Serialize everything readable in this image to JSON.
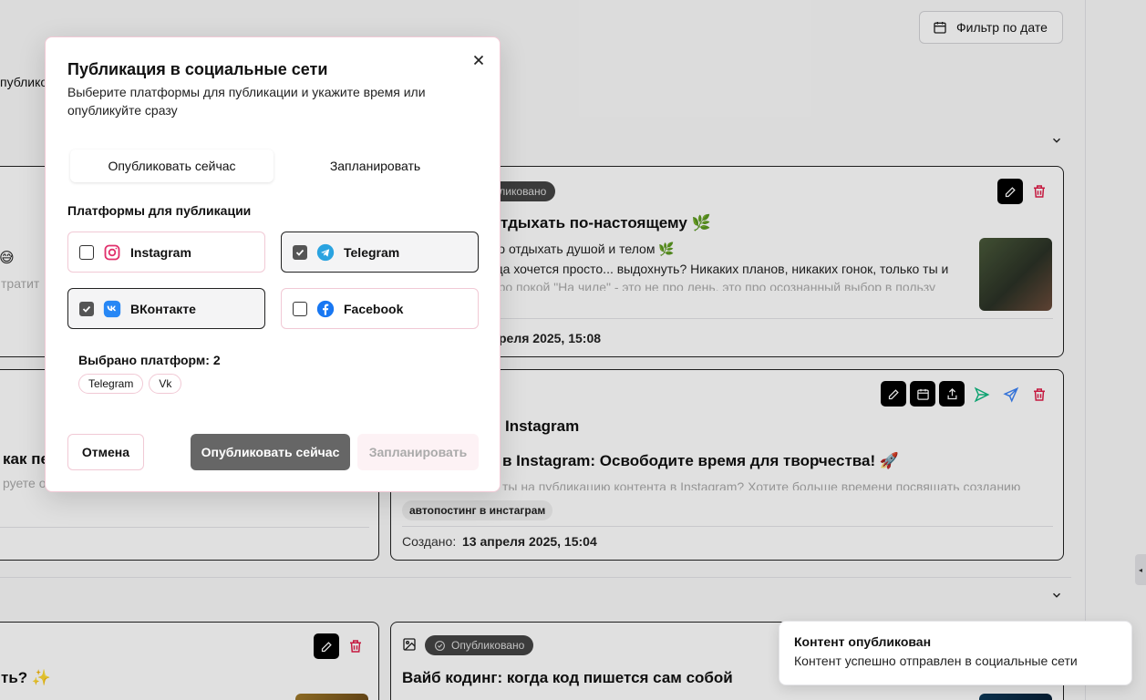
{
  "background": {
    "date_filter_label": "Фильтр по дате",
    "left_clip_text": "публико",
    "card_top_right": {
      "status": "Опубликовано",
      "title": "отдыхать по-настоящему 🌿",
      "line1": "во отдыхать душой и телом 🌿",
      "line2": "гда хочется просто... выдохнуть? Никаких планов, никаких гонок, только ты и",
      "line3": "про покой \"На чиле\" - это не про лень, это про осознанный выбор в пользу",
      "created": "реля 2025, 15:08"
    },
    "card_mid_right": {
      "title_prefix": "Instagram",
      "title": "в Instagram: Освободите время для творчества! 🚀",
      "line1": "ты на публикацию контента в Instagram? Хотите больше времени посвящать созданию",
      "tag": "автопостинг в инстаграм",
      "created_label": "Создано:",
      "created_value": "13 апреля 2025, 15:04"
    },
    "card_left_top": {
      "emoji": "😅",
      "text": "тратит"
    },
    "card_left_mid": {
      "line1": "как пе",
      "line2": "руете от"
    },
    "card_left_bottom": {
      "title": "ть? ✨"
    },
    "card_bottom_right": {
      "status": "Опубликовано",
      "title": "Вайб кодинг: когда код пишется сам собой"
    }
  },
  "modal": {
    "title": "Публикация в социальные сети",
    "description": "Выберите платформы для публикации и укажите время или опубликуйте сразу",
    "tabs": [
      {
        "label": "Опубликовать сейчас",
        "active": true
      },
      {
        "label": "Запланировать",
        "active": false
      }
    ],
    "platforms_label": "Платформы для публикации",
    "platforms": [
      {
        "name": "Instagram",
        "checked": false,
        "icon": "instagram-icon",
        "color": "#e1306c"
      },
      {
        "name": "Telegram",
        "checked": true,
        "icon": "telegram-icon",
        "color": "#2aa3e0"
      },
      {
        "name": "ВКонтакте",
        "checked": true,
        "icon": "vk-icon",
        "color": "#2787f5"
      },
      {
        "name": "Facebook",
        "checked": false,
        "icon": "facebook-icon",
        "color": "#1877f2"
      }
    ],
    "selected_count_text": "Выбрано платформ: 2",
    "selected_chips": [
      "Telegram",
      "Vk"
    ],
    "cancel_label": "Отмена",
    "publish_label": "Опубликовать сейчас",
    "schedule_label": "Запланировать"
  },
  "toast": {
    "title": "Контент опубликован",
    "description": "Контент успешно отправлен в социальные сети"
  },
  "colors": {
    "accent_border": "#f1c9d5",
    "publish_button": "#666666",
    "delete_red": "#e11d48",
    "send_green": "#10b981",
    "send_blue": "#3b82f6"
  }
}
